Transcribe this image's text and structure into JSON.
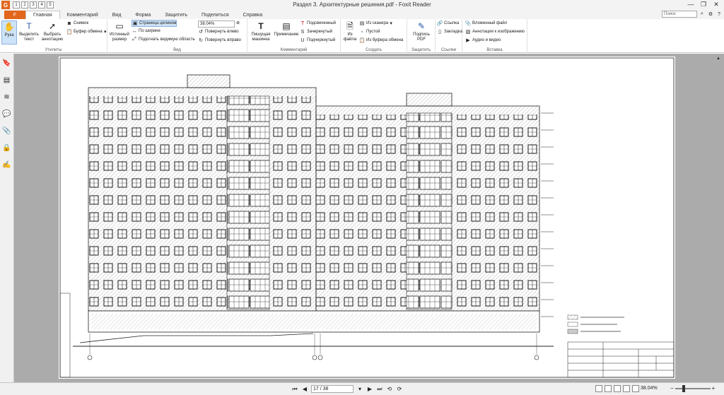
{
  "window": {
    "title": "Раздел 3. Архитектурные решения.pdf - Foxit Reader",
    "app_icon": "G",
    "qat_items": [
      "1",
      "2",
      "3",
      "4",
      "5"
    ],
    "controls": [
      "—",
      "❐",
      "✕"
    ]
  },
  "ribbon_tabs": {
    "file": "F",
    "items": [
      "Главная",
      "Комментарий",
      "Вид",
      "Форма",
      "Защитить",
      "Поделиться",
      "Справка"
    ],
    "active": "Главная",
    "search_placeholder": "Поиск"
  },
  "ribbon": {
    "groups": {
      "tools": {
        "label": "Утилиты",
        "hand": "Рука",
        "select_text": "Выделить текст",
        "select_annotation": "Выбрать аннотацию",
        "snapshot": "Снимок",
        "clipboard": "Буфер обмена"
      },
      "view": {
        "label": "Вид",
        "actual_size": "Истинный размер",
        "fit_page": "Страница целиком",
        "fit_width": "По ширине",
        "fit_visible": "Подогнать видимую область",
        "zoom_value": "38.04%",
        "rotate_left": "Повернуть влево",
        "rotate_right": "Повернуть вправо"
      },
      "comment": {
        "label": "Комментарий",
        "typewriter": "Пишущая машинка",
        "note": "Примечание",
        "highlight": "Подсвеченный",
        "strikeout": "Зачеркнутый",
        "underline": "Подчеркнутый"
      },
      "create": {
        "label": "Создать",
        "from_file": "Из файла",
        "from_scanner": "Из сканера",
        "blank": "Пустой",
        "from_clipboard": "Из буфера обмена"
      },
      "protect": {
        "label": "Защитить",
        "sign": "Подпись PDF"
      },
      "links": {
        "label": "Ссылки",
        "link": "Ссылка",
        "bookmark": "Закладка"
      },
      "insert": {
        "label": "Вставка",
        "attachment": "Вложенный файл",
        "image_annotation": "Аннотация к изображению",
        "audio_video": "Аудио и видео"
      }
    }
  },
  "status": {
    "page_display": "17 / 38",
    "zoom": "38.04%"
  }
}
